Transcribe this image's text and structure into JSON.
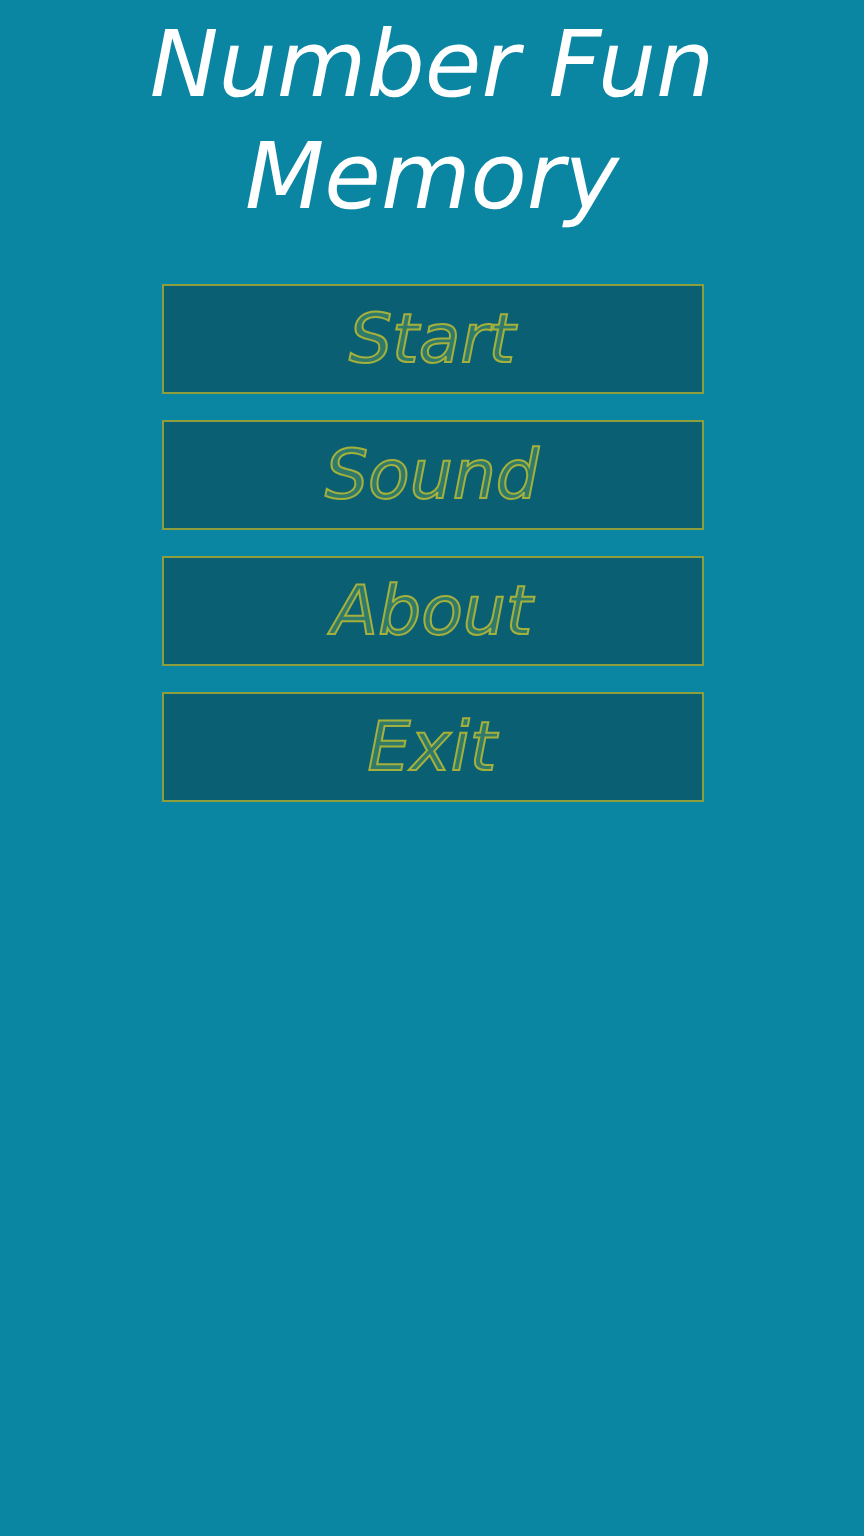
{
  "title": [
    "Number Fun",
    "Memory"
  ],
  "menu": [
    {
      "label": "Start"
    },
    {
      "label": "Sound"
    },
    {
      "label": "About"
    },
    {
      "label": "Exit"
    }
  ]
}
